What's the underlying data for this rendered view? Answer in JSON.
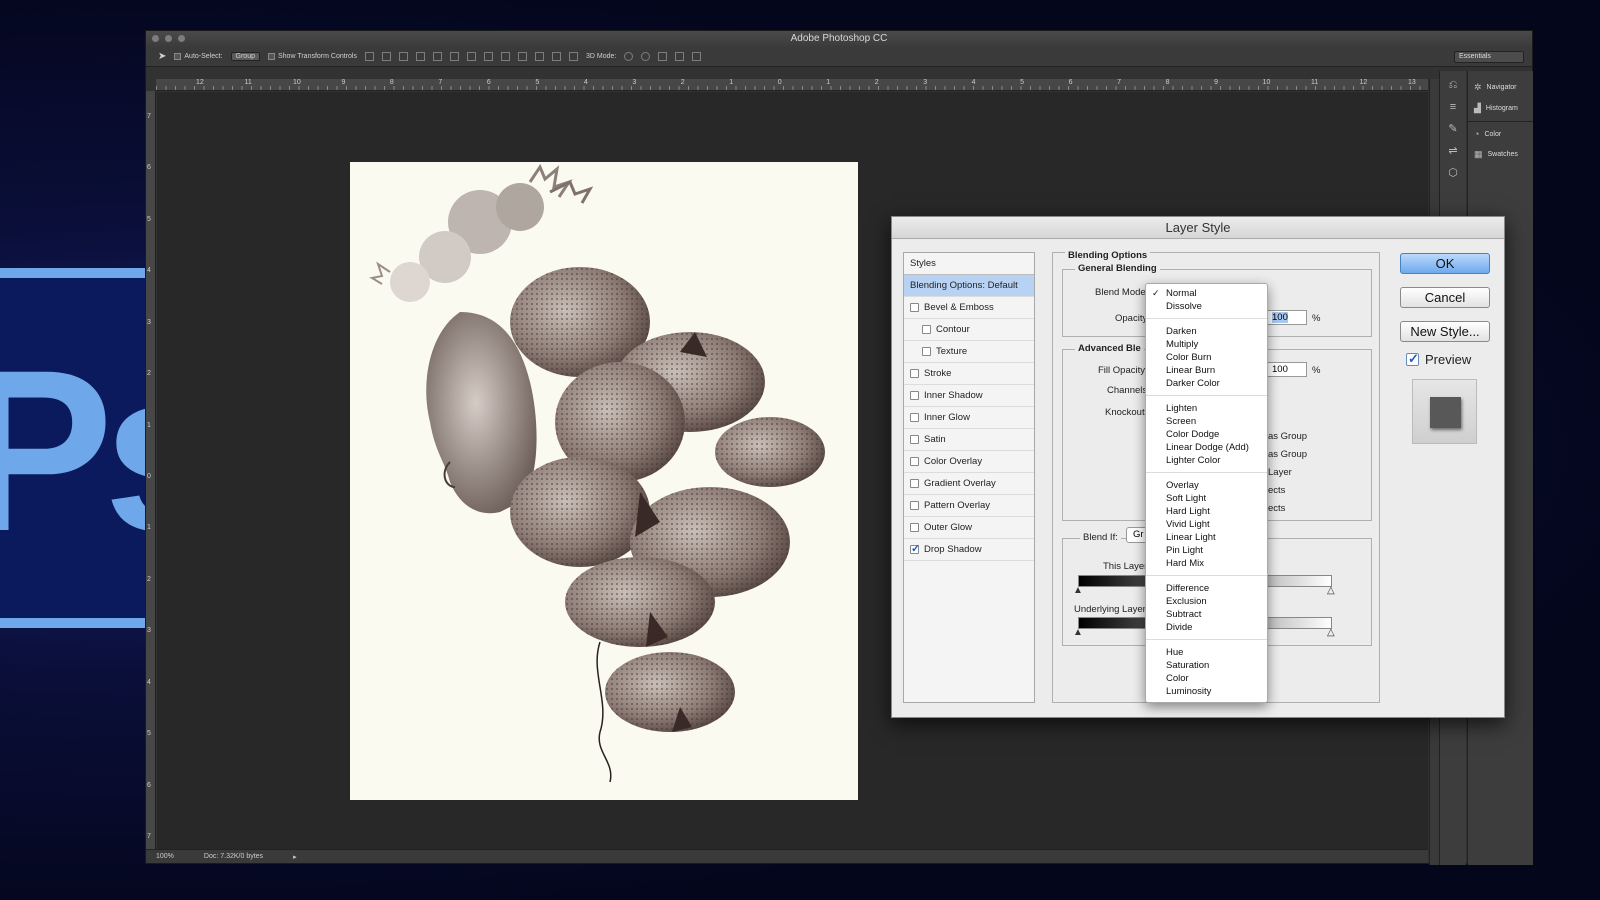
{
  "app": {
    "title": "Adobe Photoshop CC",
    "workspace": "Essentials"
  },
  "options_bar": {
    "auto_select_label": "Auto-Select:",
    "auto_select_value": "Group",
    "show_transform_label": "Show Transform Controls",
    "mode_3d_label": "3D Mode:"
  },
  "ruler_top": [
    "12",
    "11",
    "10",
    "9",
    "8",
    "7",
    "6",
    "5",
    "4",
    "3",
    "2",
    "1",
    "0",
    "1",
    "2",
    "3",
    "4",
    "5",
    "6",
    "7",
    "8",
    "9",
    "10",
    "11",
    "12",
    "13"
  ],
  "ruler_left": [
    "7",
    "6",
    "5",
    "4",
    "3",
    "2",
    "1",
    "0",
    "1",
    "2",
    "3",
    "4",
    "5",
    "6",
    "7"
  ],
  "status": {
    "zoom": "100%",
    "doc": "Doc: 7.32K/0 bytes"
  },
  "panels": [
    {
      "label": "Navigator",
      "icon": "navigator-icon"
    },
    {
      "label": "Histogram",
      "icon": "histogram-icon"
    },
    {
      "label": "Color",
      "icon": "color-icon"
    },
    {
      "label": "Swatches",
      "icon": "swatches-icon"
    }
  ],
  "dialog": {
    "title": "Layer Style",
    "styles_header": "Styles",
    "styles": [
      {
        "label": "Blending Options: Default",
        "checkbox": false,
        "selected": true,
        "indent": false,
        "checked": false
      },
      {
        "label": "Bevel & Emboss",
        "checkbox": true,
        "selected": false,
        "indent": false,
        "checked": false
      },
      {
        "label": "Contour",
        "checkbox": true,
        "selected": false,
        "indent": true,
        "checked": false
      },
      {
        "label": "Texture",
        "checkbox": true,
        "selected": false,
        "indent": true,
        "checked": false
      },
      {
        "label": "Stroke",
        "checkbox": true,
        "selected": false,
        "indent": false,
        "checked": false
      },
      {
        "label": "Inner Shadow",
        "checkbox": true,
        "selected": false,
        "indent": false,
        "checked": false
      },
      {
        "label": "Inner Glow",
        "checkbox": true,
        "selected": false,
        "indent": false,
        "checked": false
      },
      {
        "label": "Satin",
        "checkbox": true,
        "selected": false,
        "indent": false,
        "checked": false
      },
      {
        "label": "Color Overlay",
        "checkbox": true,
        "selected": false,
        "indent": false,
        "checked": false
      },
      {
        "label": "Gradient Overlay",
        "checkbox": true,
        "selected": false,
        "indent": false,
        "checked": false
      },
      {
        "label": "Pattern Overlay",
        "checkbox": true,
        "selected": false,
        "indent": false,
        "checked": false
      },
      {
        "label": "Outer Glow",
        "checkbox": true,
        "selected": false,
        "indent": false,
        "checked": false
      },
      {
        "label": "Drop Shadow",
        "checkbox": true,
        "selected": false,
        "indent": false,
        "checked": true
      }
    ],
    "blending": {
      "section_title": "Blending Options",
      "general_title": "General Blending",
      "blend_mode_label": "Blend Mode",
      "opacity_label": "Opacity",
      "opacity_value": "100",
      "percent": "%",
      "advanced_title": "Advanced Ble",
      "fill_opacity_label": "Fill Opacity",
      "fill_opacity_value": "100",
      "channels_label": "Channels",
      "knockout_label": "Knockout",
      "partial_right": [
        "as Group",
        "as Group",
        "Layer",
        "ects",
        "ects"
      ],
      "blend_if_label": "Blend If:",
      "blend_if_value": "Gr",
      "this_layer_label": "This Layer",
      "underlying_layer_label": "Underlying Layer"
    },
    "buttons": {
      "ok": "OK",
      "cancel": "Cancel",
      "new_style": "New Style..."
    },
    "preview_label": "Preview"
  },
  "blend_modes": [
    [
      "Normal",
      "Dissolve"
    ],
    [
      "Darken",
      "Multiply",
      "Color Burn",
      "Linear Burn",
      "Darker Color"
    ],
    [
      "Lighten",
      "Screen",
      "Color Dodge",
      "Linear Dodge (Add)",
      "Lighter Color"
    ],
    [
      "Overlay",
      "Soft Light",
      "Hard Light",
      "Vivid Light",
      "Linear Light",
      "Pin Light",
      "Hard Mix"
    ],
    [
      "Difference",
      "Exclusion",
      "Subtract",
      "Divide"
    ],
    [
      "Hue",
      "Saturation",
      "Color",
      "Luminosity"
    ]
  ],
  "blend_mode_selected": "Normal",
  "logo_text": "Ps"
}
